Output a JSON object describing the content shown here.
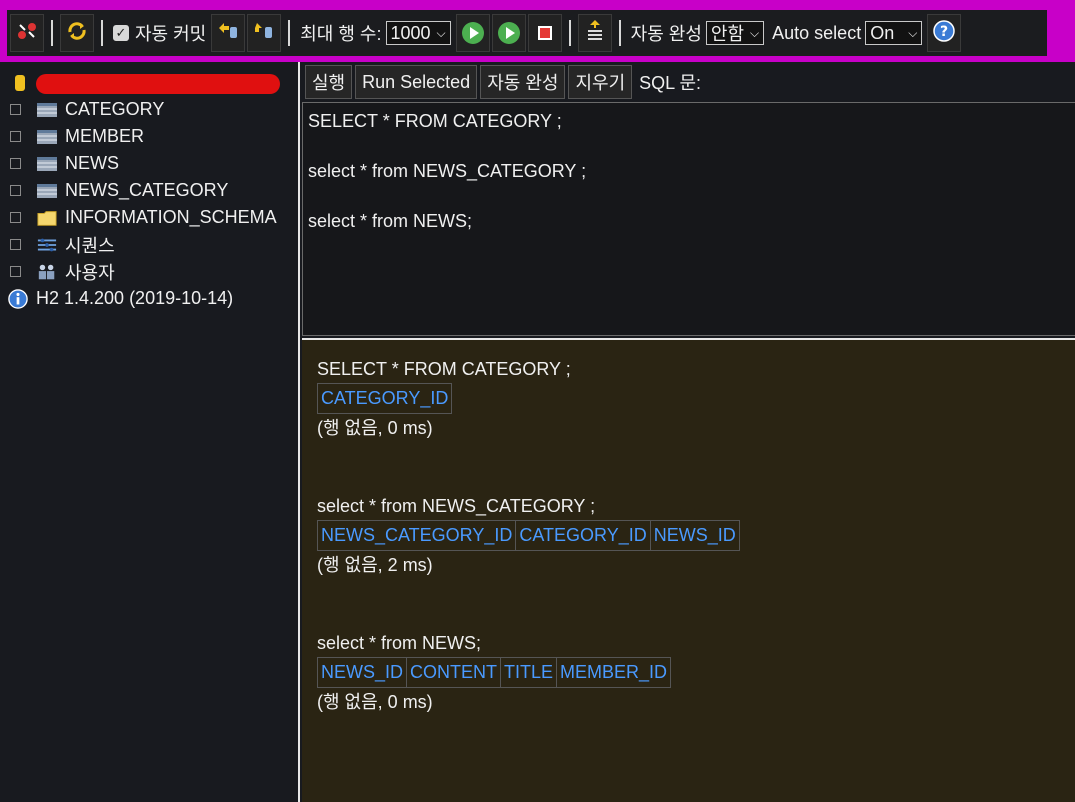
{
  "toolbar": {
    "autocommit_label": "자동 커밋",
    "autocommit_checked": "✓",
    "maxrows_label": "최대 행 수:",
    "maxrows_value": "1000",
    "autocomplete_label": "자동 완성",
    "autocomplete_value": "안함",
    "autoselect_label": "Auto select",
    "autoselect_value": "On",
    "icons": [
      "disconnect-icon",
      "refresh-icon",
      "rollback-icon",
      "commit-icon",
      "run-icon",
      "run-selected-icon",
      "stop-icon",
      "history-icon",
      "help-icon"
    ]
  },
  "tree": {
    "items": [
      {
        "label": "CATEGORY",
        "icon": "table-icon"
      },
      {
        "label": "MEMBER",
        "icon": "table-icon"
      },
      {
        "label": "NEWS",
        "icon": "table-icon"
      },
      {
        "label": "NEWS_CATEGORY",
        "icon": "table-icon"
      },
      {
        "label": "INFORMATION_SCHEMA",
        "icon": "folder-icon"
      },
      {
        "label": "시퀀스",
        "icon": "sequence-icon"
      },
      {
        "label": "사용자",
        "icon": "users-icon"
      }
    ],
    "version": "H2 1.4.200 (2019-10-14)"
  },
  "buttons": {
    "run": "실행",
    "run_selected": "Run Selected",
    "auto_complete": "자동 완성",
    "clear": "지우기",
    "sql_label": "SQL 문:"
  },
  "editor": {
    "lines": [
      "SELECT * FROM CATEGORY ;",
      "",
      "select * from NEWS_CATEGORY ;",
      "",
      "select * from NEWS;"
    ]
  },
  "results": [
    {
      "sql": "SELECT * FROM CATEGORY ;",
      "columns": [
        "CATEGORY_ID"
      ],
      "status": "(행 없음, 0 ms)"
    },
    {
      "sql": "select * from NEWS_CATEGORY ;",
      "columns": [
        "NEWS_CATEGORY_ID",
        "CATEGORY_ID",
        "NEWS_ID"
      ],
      "status": "(행 없음, 2 ms)"
    },
    {
      "sql": "select * from NEWS;",
      "columns": [
        "NEWS_ID",
        "CONTENT",
        "TITLE",
        "MEMBER_ID"
      ],
      "status": "(행 없음, 0 ms)"
    }
  ],
  "colors": {
    "toolbar_border": "#c800c8",
    "column_header": "#4a9aff",
    "results_bg": "#2a2413"
  }
}
